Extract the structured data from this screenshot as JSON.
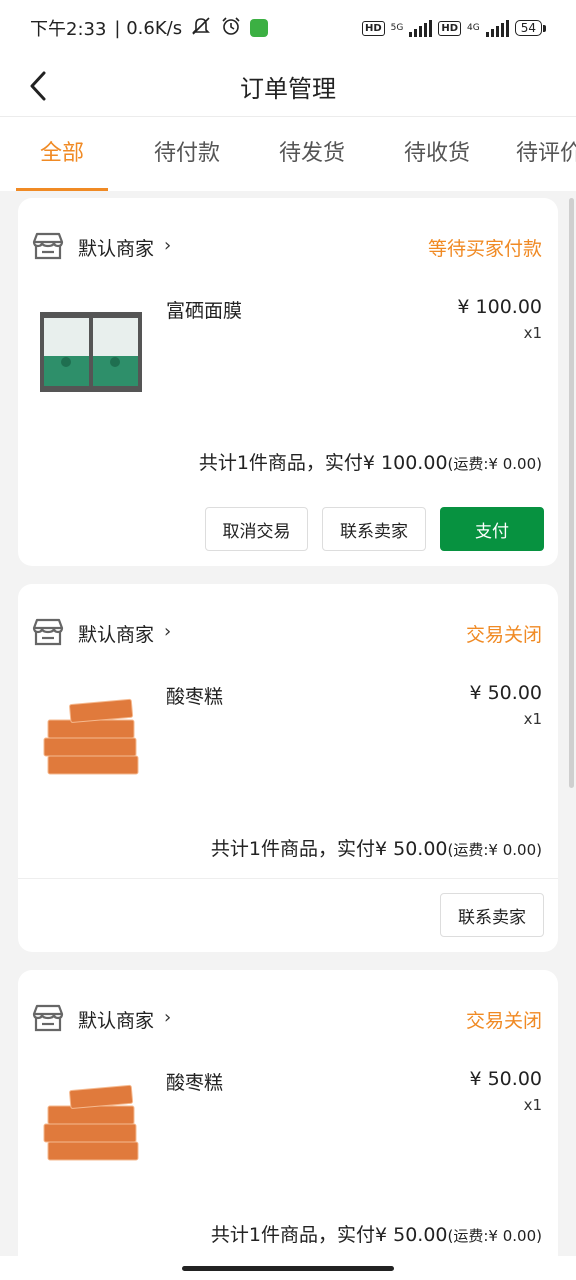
{
  "status_bar": {
    "time": "下午2:33",
    "net_speed": "| 0.6K/s",
    "hd1": "HD",
    "net1": "5G",
    "hd2": "HD",
    "net2": "4G",
    "battery": "54"
  },
  "header": {
    "title": "订单管理"
  },
  "tabs": [
    "全部",
    "待付款",
    "待发货",
    "待收货",
    "待评价"
  ],
  "orders": [
    {
      "shop": "默认商家",
      "status": "等待买家付款",
      "product": "富硒面膜",
      "price": "¥ 100.00",
      "qty": "x1",
      "summary": "共计1件商品，实付¥ 100.00",
      "shipping": "(运费:¥ 0.00)",
      "buttons": [
        "取消交易",
        "联系卖家",
        "支付"
      ]
    },
    {
      "shop": "默认商家",
      "status": "交易关闭",
      "product": "酸枣糕",
      "price": "¥ 50.00",
      "qty": "x1",
      "summary": "共计1件商品，实付¥ 50.00",
      "shipping": "(运费:¥ 0.00)",
      "buttons": [
        "联系卖家"
      ]
    },
    {
      "shop": "默认商家",
      "status": "交易关闭",
      "product": "酸枣糕",
      "price": "¥ 50.00",
      "qty": "x1",
      "summary": "共计1件商品，实付¥ 50.00",
      "shipping": "(运费:¥ 0.00)",
      "buttons": []
    }
  ],
  "colors": {
    "accent": "#f08a24",
    "primary_button": "#079240"
  },
  "icons": [
    "back-arrow-icon",
    "store-icon",
    "chevron-right-icon",
    "mute-icon",
    "alarm-icon",
    "signal-icon",
    "battery-icon"
  ]
}
